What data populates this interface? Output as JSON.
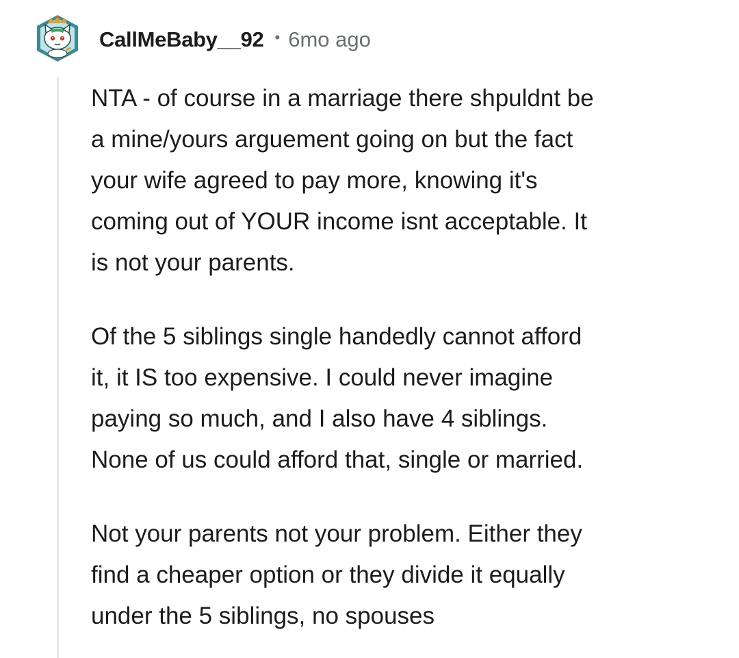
{
  "comment": {
    "author": "CallMeBaby__92",
    "separator": "•",
    "age": "6mo ago",
    "paragraphs": [
      "NTA - of course in a marriage there shpuldnt be\na mine/yours arguement going on but the fact\nyour wife agreed to pay more, knowing it's\ncoming out of YOUR income isnt acceptable. It\nis not your parents.",
      "Of the 5 siblings single handedly cannot afford\nit, it IS too expensive. I could never imagine\npaying so much, and I also have 4 siblings.\nNone of us could afford that, single or married.",
      "Not your parents not your problem. Either they\nfind a cheaper option or they divide it equally\nunder the 5 siblings, no spouses"
    ]
  },
  "colors": {
    "text": "#1c1c1c",
    "meta": "#6b6f73",
    "thread_line": "#e5e7e9",
    "avatar_frame": "#3f8a8f",
    "avatar_bg": "#bfe4ea"
  },
  "icons": {
    "avatar": "snoo-cat-avatar-icon"
  }
}
